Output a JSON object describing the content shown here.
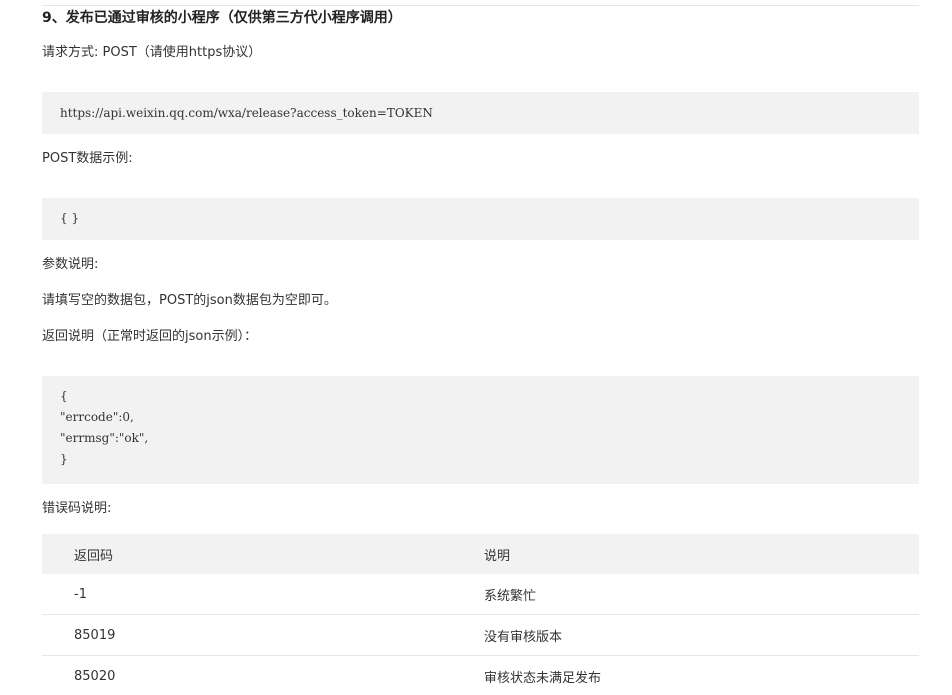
{
  "heading": "9、发布已通过审核的小程序（仅供第三方代小程序调用）",
  "request_method": "请求方式: POST（请使用https协议）",
  "endpoint": "https://api.weixin.qq.com/wxa/release?access_token=TOKEN",
  "post_example_label": "POST数据示例:",
  "post_example_code": "{ }",
  "params_label": "参数说明:",
  "params_desc": "请填写空的数据包，POST的json数据包为空即可。",
  "return_label": "返回说明（正常时返回的json示例）：",
  "return_code_lines": [
    "{",
    "\"errcode\":0,",
    "\"errmsg\":\"ok\",",
    "}"
  ],
  "error_label": "错误码说明:",
  "error_table": {
    "headers": [
      "返回码",
      "说明"
    ],
    "rows": [
      [
        "-1",
        "系统繁忙"
      ],
      [
        "85019",
        "没有审核版本"
      ],
      [
        "85020",
        "审核状态未满足发布"
      ]
    ]
  }
}
